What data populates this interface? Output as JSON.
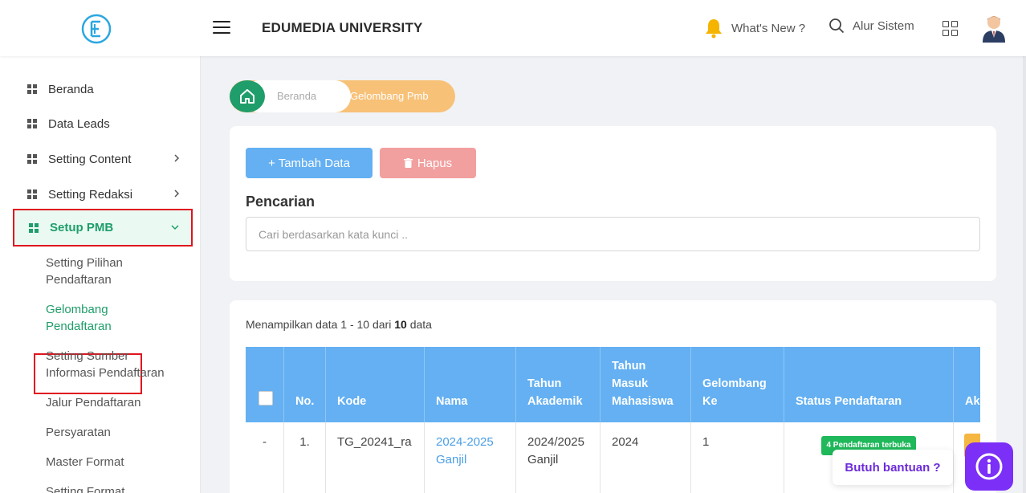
{
  "header": {
    "title": "EDUMEDIA UNIVERSITY",
    "whats_new": "What's New ?",
    "alur_sistem": "Alur Sistem"
  },
  "sidebar": {
    "items": [
      {
        "label": "Beranda"
      },
      {
        "label": "Data Leads"
      },
      {
        "label": "Setting Content"
      },
      {
        "label": "Setting Redaksi"
      },
      {
        "label": "Setup PMB"
      }
    ],
    "subitems": [
      {
        "line1": "Setting Pilihan",
        "line2": "Pendaftaran"
      },
      {
        "line1": "Gelombang",
        "line2": "Pendaftaran"
      },
      {
        "line1": "Setting Sumber",
        "line2": "Informasi Pendaftaran"
      },
      {
        "line1": "Jalur Pendaftaran"
      },
      {
        "line1": "Persyaratan"
      },
      {
        "line1": "Master Format"
      },
      {
        "line1": "Setting Format"
      }
    ]
  },
  "breadcrumb": {
    "home": "Beranda",
    "current": "Gelombang Pmb"
  },
  "toolbar": {
    "add_label": "+ Tambah Data",
    "delete_label": "Hapus"
  },
  "search": {
    "label": "Pencarian",
    "placeholder": "Cari berdasarkan kata kunci .."
  },
  "table": {
    "showing_prefix": "Menampilkan data 1 - 10 dari",
    "showing_total": "10",
    "showing_suffix": "data",
    "headers": {
      "no": "No.",
      "kode": "Kode",
      "nama": "Nama",
      "tahun_akademik": "Tahun Akademik",
      "tahun_masuk": "Tahun Masuk Mahasiswa",
      "gelombang": "Gelombang Ke",
      "status": "Status Pendaftaran",
      "aksi": "Aksi"
    },
    "rows": [
      {
        "check": "-",
        "no": "1.",
        "kode": "TG_20241_ra",
        "nama": "2024-2025 Ganjil",
        "tahun_akademik": "2024/2025 Ganjil",
        "tahun_masuk": "2024",
        "gelombang": "1",
        "status": "4 Pendaftaran terbuka"
      }
    ]
  },
  "help": {
    "label": "Butuh bantuan ?"
  },
  "colors": {
    "primary_green": "#1f9d6a",
    "table_header_blue": "#64b0f2",
    "delete_red": "#f29f9f",
    "breadcrumb_orange": "#f8c178",
    "help_purple": "#7b2ff7",
    "highlight_red": "#e0141e"
  }
}
